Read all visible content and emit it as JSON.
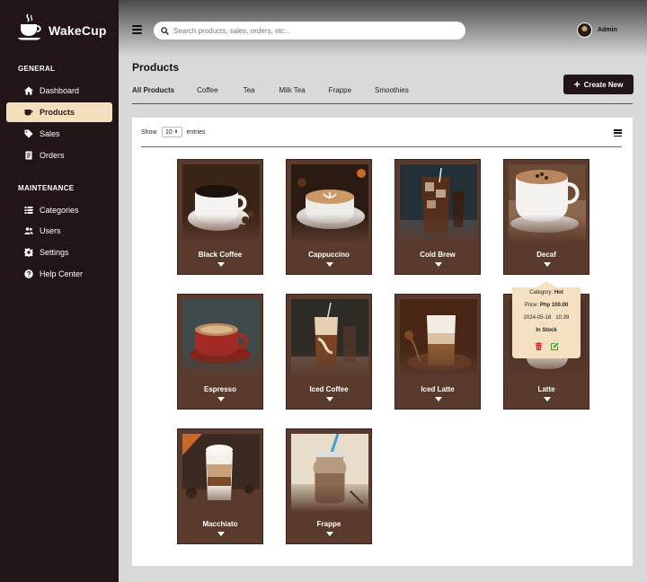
{
  "brand": {
    "name": "WakeCup"
  },
  "sidebar": {
    "general_title": "GENERAL",
    "maintenance_title": "MAINTENANCE",
    "general": [
      {
        "label": "Dashboard",
        "icon": "home-icon"
      },
      {
        "label": "Products",
        "icon": "coffee-cup-icon",
        "active": true
      },
      {
        "label": "Sales",
        "icon": "tag-icon"
      },
      {
        "label": "Orders",
        "icon": "receipt-icon"
      }
    ],
    "maintenance": [
      {
        "label": "Categories",
        "icon": "list-icon"
      },
      {
        "label": "Users",
        "icon": "users-icon"
      },
      {
        "label": "Settings",
        "icon": "gear-icon"
      },
      {
        "label": "Help Center",
        "icon": "question-icon"
      }
    ]
  },
  "header": {
    "search_placeholder": "Search products, sales, orders, etc...",
    "admin_label": "Admin"
  },
  "page": {
    "title": "Products",
    "create_label": "Create New",
    "tabs": [
      "All Products",
      "Coffee",
      "Tea",
      "Milk Tea",
      "Frappe",
      "Smoothies"
    ],
    "active_tab": "All Products"
  },
  "table": {
    "show_label": "Show",
    "entries_value": "10",
    "entries_label": "entries"
  },
  "products": [
    {
      "name": "Black Coffee"
    },
    {
      "name": "Cappuccino"
    },
    {
      "name": "Cold Brew"
    },
    {
      "name": "Decaf"
    },
    {
      "name": "Espresso"
    },
    {
      "name": "Iced Coffee"
    },
    {
      "name": "Iced Latte"
    },
    {
      "name": "Latte"
    },
    {
      "name": "Macchiato"
    },
    {
      "name": "Frappe"
    }
  ],
  "tooltip": {
    "category_label": "Category:",
    "category_value": "Hot",
    "price_label": "Price:",
    "price_value": "Php 100.00",
    "date": "2024-05-16",
    "time": "10:39",
    "status": "In Stock"
  },
  "colors": {
    "sidebar_bg": "#211517",
    "active_nav": "#f3dfbe",
    "card_bg": "#5a3a2c",
    "delete": "#d0191f",
    "edit": "#1fa32a"
  }
}
